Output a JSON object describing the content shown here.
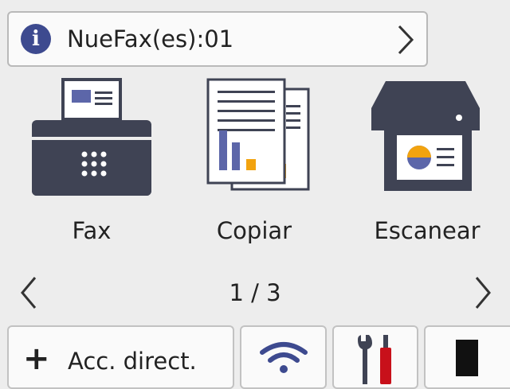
{
  "notification": {
    "icon": "info-icon",
    "text": "NueFax(es):01",
    "chevron": "chevron-right-icon"
  },
  "apps": [
    {
      "label": "Fax",
      "icon": "fax-machine-icon"
    },
    {
      "label": "Copiar",
      "icon": "copy-documents-icon"
    },
    {
      "label": "Escanear",
      "icon": "scanner-icon"
    }
  ],
  "pager": {
    "page": "1 / 3"
  },
  "bottom_bar": {
    "shortcut_label": "Acc. direct.",
    "shortcut_icon": "plus-icon",
    "wifi_icon": "wifi-icon",
    "tools_icon": "settings-tools-icon",
    "toner_icon": "toner-icon"
  },
  "colors": {
    "icon_dark": "#3f4354",
    "info_blue": "#3d4a8f",
    "accent_orange": "#f2a30f",
    "accent_blue": "#5c66a9",
    "tool_red": "#c8101a"
  }
}
